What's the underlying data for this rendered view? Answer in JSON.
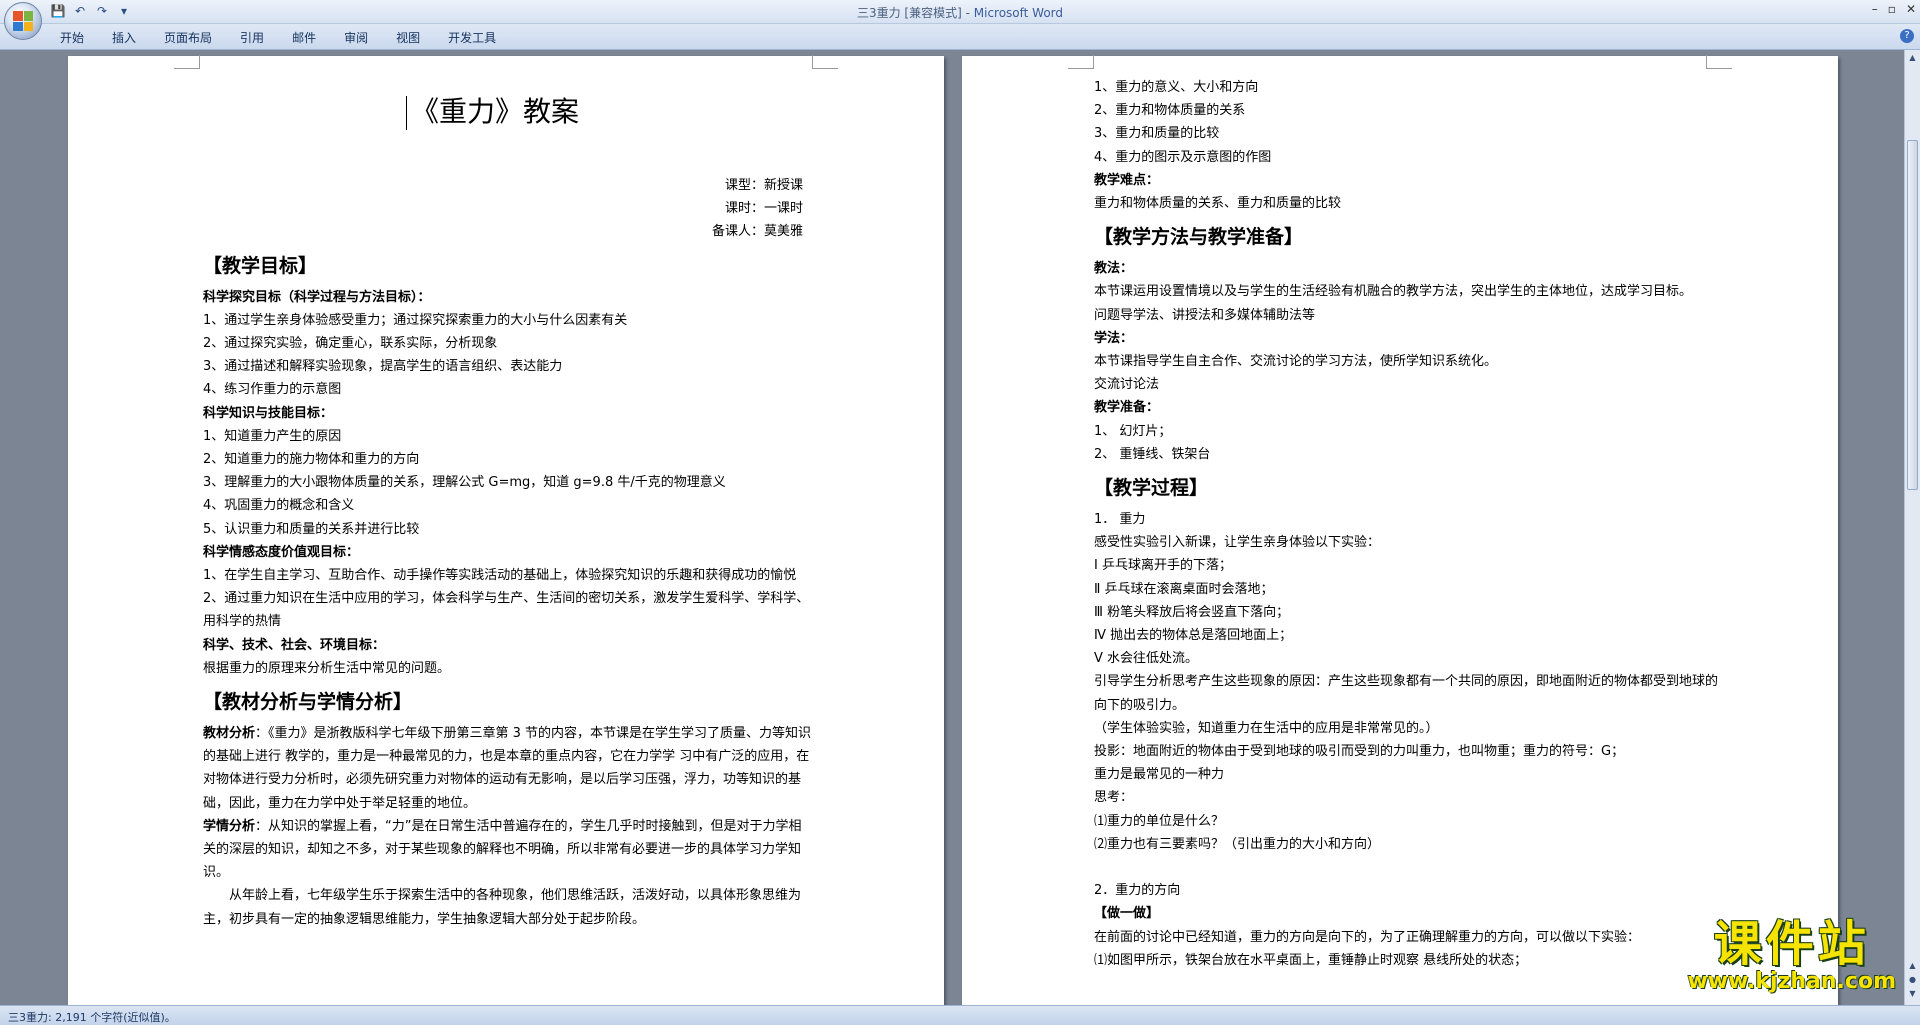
{
  "window": {
    "title_doc": "三3重力 [兼容模式]",
    "title_sep": " - ",
    "title_app": "Microsoft Word"
  },
  "quick_access": {
    "save": "💾",
    "undo": "↶",
    "redo": "↷",
    "more": "▾"
  },
  "window_controls": {
    "minimize": "–",
    "maximize": "▫",
    "close": "✕"
  },
  "ribbon": {
    "tabs": [
      "开始",
      "插入",
      "页面布局",
      "引用",
      "邮件",
      "审阅",
      "视图",
      "开发工具"
    ],
    "help": "?"
  },
  "page1": {
    "title": "《重力》教案",
    "meta": [
      "课型：新授课",
      "课时：一课时",
      "备课人：莫美雅"
    ],
    "sec1_heading": "【教学目标】",
    "sub1": "科学探究目标（科学过程与方法目标）：",
    "sub1_items": [
      "1、通过学生亲身体验感受重力；通过探究探索重力的大小与什么因素有关",
      "2、通过探究实验，确定重心，联系实际，分析现象",
      "3、通过描述和解释实验现象，提高学生的语言组织、表达能力",
      "4、练习作重力的示意图"
    ],
    "sub2": "科学知识与技能目标：",
    "sub2_items": [
      "1、知道重力产生的原因",
      "2、知道重力的施力物体和重力的方向",
      "3、理解重力的大小跟物体质量的关系，理解公式 G=mg，知道 g=9.8 牛/千克的物理意义",
      "4、巩固重力的概念和含义",
      "5、认识重力和质量的关系并进行比较"
    ],
    "sub3": "科学情感态度价值观目标：",
    "sub3_items": [
      "1、在学生自主学习、互助合作、动手操作等实践活动的基础上，体验探究知识的乐趣和获得成功的愉悦",
      "2、通过重力知识在生活中应用的学习，体会科学与生产、生活间的密切关系，激发学生爱科学、学科学、用科学的热情"
    ],
    "sub4": "科学、技术、社会、环境目标：",
    "sub4_text": "根据重力的原理来分析生活中常见的问题。",
    "sec2_heading": "【教材分析与学情分析】",
    "para1_label": "教材分析",
    "para1": "：《重力》是浙教版科学七年级下册第三章第 3 节的内容，本节课是在学生学习了质量、力等知识的基础上进行 教学的，重力是一种最常见的力，也是本章的重点内容，它在力学学 习中有广泛的应用，在对物体进行受力分析时，必须先研究重力对物体的运动有无影响，是以后学习压强，浮力，功等知识的基础，因此，重力在力学中处于举足轻重的地位。",
    "para2_label": "学情分析",
    "para2": "：从知识的掌握上看，“力”是在日常生活中普遍存在的，学生几乎时时接触到，但是对于力学相关的深层的知识，却知之不多，对于某些现象的解释也不明确，所以非常有必要进一步的具体学习力学知识。",
    "para3": "从年龄上看，七年级学生乐于探索生活中的各种现象，他们思维活跃，活泼好动，以具体形象思维为主，初步具有一定的抽象逻辑思维能力，学生抽象逻辑大部分处于起步阶段。"
  },
  "page2": {
    "key_items": [
      "1、重力的意义、大小和方向",
      "2、重力和物体质量的关系",
      "3、重力和质量的比较",
      "4、重力的图示及示意图的作图"
    ],
    "difficulty_label": "教学难点：",
    "difficulty_text": "重力和物体质量的关系、重力和质量的比较",
    "sec3_heading": "【教学方法与教学准备】",
    "teach_label": "教法：",
    "teach_text": "本节课运用设置情境以及与学生的生活经验有机融合的教学方法，突出学生的主体地位，达成学习目标。",
    "teach_text2": "问题导学法、讲授法和多媒体辅助法等",
    "learn_label": "学法：",
    "learn_text": "本节课指导学生自主合作、交流讨论的学习方法，使所学知识系统化。",
    "learn_text2": "交流讨论法",
    "prep_label": "教学准备：",
    "prep_items": [
      "1、 幻灯片；",
      "2、 重锤线、铁架台"
    ],
    "sec4_heading": "【教学过程】",
    "step1": "1． 重力",
    "intro": "感受性实验引入新课，让学生亲身体验以下实验：",
    "experiments": [
      "Ⅰ 乒乓球离开手的下落；",
      "Ⅱ 乒乓球在滚离桌面时会落地；",
      "Ⅲ 粉笔头释放后将会竖直下落向；",
      "Ⅳ 抛出去的物体总是落回地面上；",
      "Ⅴ 水会往低处流。"
    ],
    "guide": "引导学生分析思考产生这些现象的原因：产生这些现象都有一个共同的原因，即地面附近的物体都受到地球的向下的吸引力。",
    "student_exp": "（学生体验实验，知道重力在生活中的应用是非常常见的。）",
    "projection": "投影：地面附近的物体由于受到地球的吸引而受到的力叫重力，也叫物重；重力的符号：G；",
    "projection2": "重力是最常见的一种力",
    "think_label": "思考：",
    "think_items": [
      "⑴重力的单位是什么？",
      "⑵重力也有三要素吗？（引出重力的大小和方向）"
    ],
    "step2": "2．重力的方向",
    "do_it": "【做一做】",
    "do_text": "在前面的讨论中已经知道，重力的方向是向下的，为了正确理解重力的方向，可以做以下实验：",
    "cut_line": "⑴如图甲所示，铁架台放在水平桌面上，重锤静止时观察 悬线所处的状态；"
  },
  "statusbar": {
    "text": "三3重力: 2,191 个字符(近似值)。"
  },
  "watermark": {
    "title": "课件站",
    "url": "www.kjzhan.com"
  },
  "colors": {
    "ribbon": "#cbd9ee",
    "workspace": "#7b8594",
    "watermark": "#f6e400"
  }
}
